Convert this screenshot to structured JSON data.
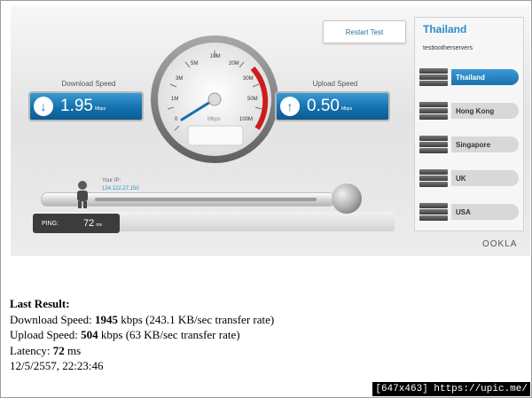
{
  "widget": {
    "restart_label": "Restart Test",
    "download": {
      "caption": "Download Speed",
      "value": "1.95",
      "unit": "Mbps"
    },
    "upload": {
      "caption": "Upload Speed",
      "value": "0.50",
      "unit": "Mbps"
    },
    "gauge": {
      "unit": "Mbps",
      "labels": [
        "0",
        "1M",
        "3M",
        "5M",
        "10M",
        "20M",
        "30M",
        "50M",
        "100M"
      ]
    },
    "ip_caption": "Your IP:",
    "ip_value": "124.122.27.150",
    "ping": {
      "caption": "PING:",
      "value": "72",
      "unit": "ms"
    },
    "server_panel": {
      "country": "Thailand",
      "subtitle": "testtootherservers",
      "servers": [
        {
          "label": "Thailand",
          "active": true
        },
        {
          "label": "Hong Kong",
          "active": false
        },
        {
          "label": "Singapore",
          "active": false
        },
        {
          "label": "UK",
          "active": false
        },
        {
          "label": "USA",
          "active": false
        }
      ]
    },
    "brand": "OOKLA"
  },
  "results": {
    "heading": "Last Result:",
    "download_prefix": "Download Speed: ",
    "download_value": "1945",
    "download_suffix": " kbps (243.1 KB/sec transfer rate)",
    "upload_prefix": "Upload Speed: ",
    "upload_value": "504",
    "upload_suffix": " kbps (63 KB/sec transfer rate)",
    "latency_prefix": "Latency: ",
    "latency_value": "72",
    "latency_suffix": " ms",
    "datetime": "12/5/2557, 22:23:46"
  },
  "stamp": "[647x463] https://upic.me/",
  "colors": {
    "accent": "#1a70ae",
    "link": "#2b8cc9"
  }
}
